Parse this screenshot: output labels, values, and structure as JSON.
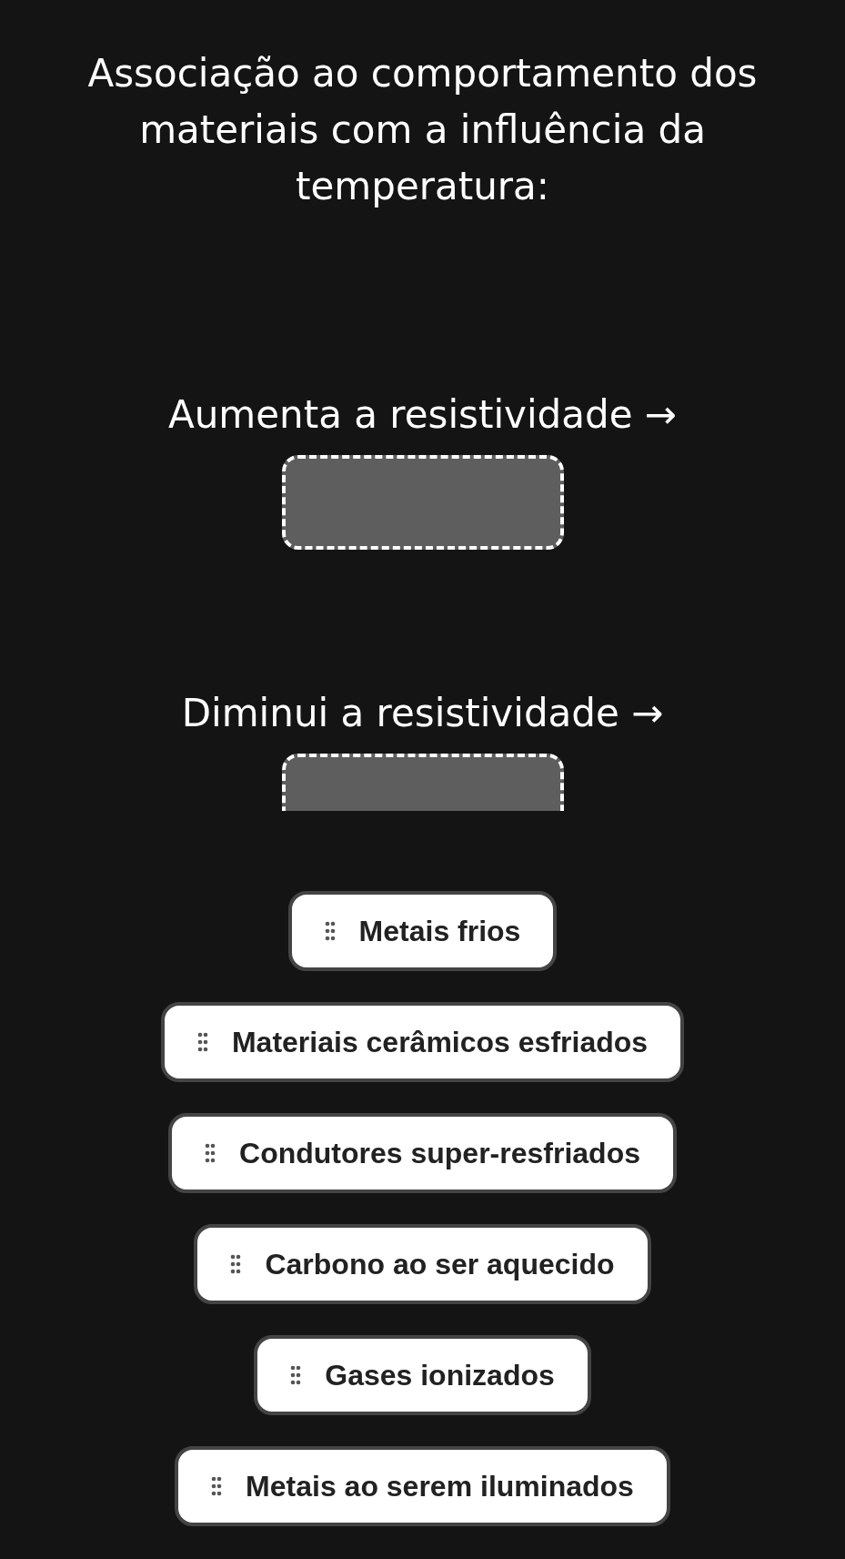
{
  "title": "Associação ao comportamento dos materiais com a influência da temperatura:",
  "categories": [
    {
      "label": "Aumenta a resistividade →"
    },
    {
      "label": "Diminui a resistividade →"
    }
  ],
  "items": [
    {
      "label": "Metais frios"
    },
    {
      "label": "Materiais cerâmicos esfriados"
    },
    {
      "label": "Condutores super-resfriados"
    },
    {
      "label": "Carbono ao ser aquecido"
    },
    {
      "label": "Gases ionizados"
    },
    {
      "label": "Metais ao serem iluminados"
    }
  ]
}
